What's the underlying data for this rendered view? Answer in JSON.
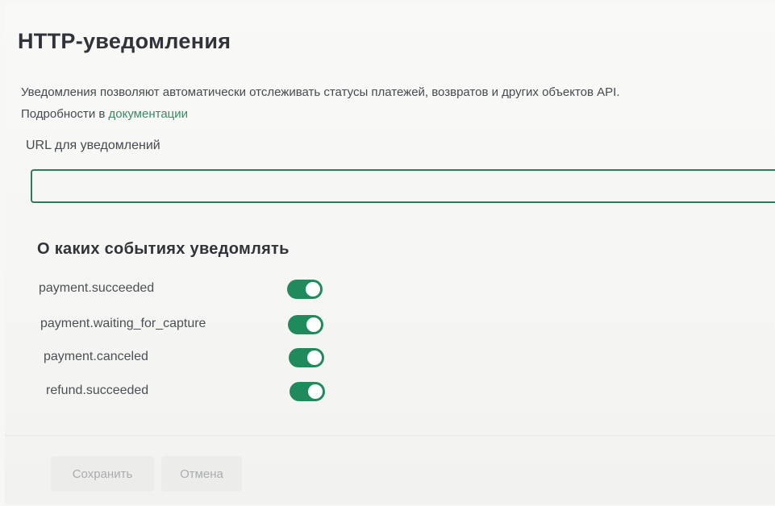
{
  "title": "HTTP-уведомления",
  "description": {
    "text": "Уведомления позволяют автоматически отслеживать статусы платежей, возвратов и других объектов API. Подробности в ",
    "link": "документации"
  },
  "url_field": {
    "label": "URL для уведомлений",
    "value": "",
    "placeholder": ""
  },
  "events": {
    "title": "О каких событиях уведомлять",
    "items": [
      {
        "label": "payment.succeeded",
        "enabled": true
      },
      {
        "label": "payment.waiting_for_capture",
        "enabled": true
      },
      {
        "label": "payment.canceled",
        "enabled": true
      },
      {
        "label": "refund.succeeded",
        "enabled": true
      }
    ]
  },
  "actions": {
    "save_label": "Сохранить",
    "cancel_label": "Отмена"
  },
  "colors": {
    "accent": "#1f8a5c",
    "link": "#3a8a64",
    "input_border": "#2f7a59"
  }
}
